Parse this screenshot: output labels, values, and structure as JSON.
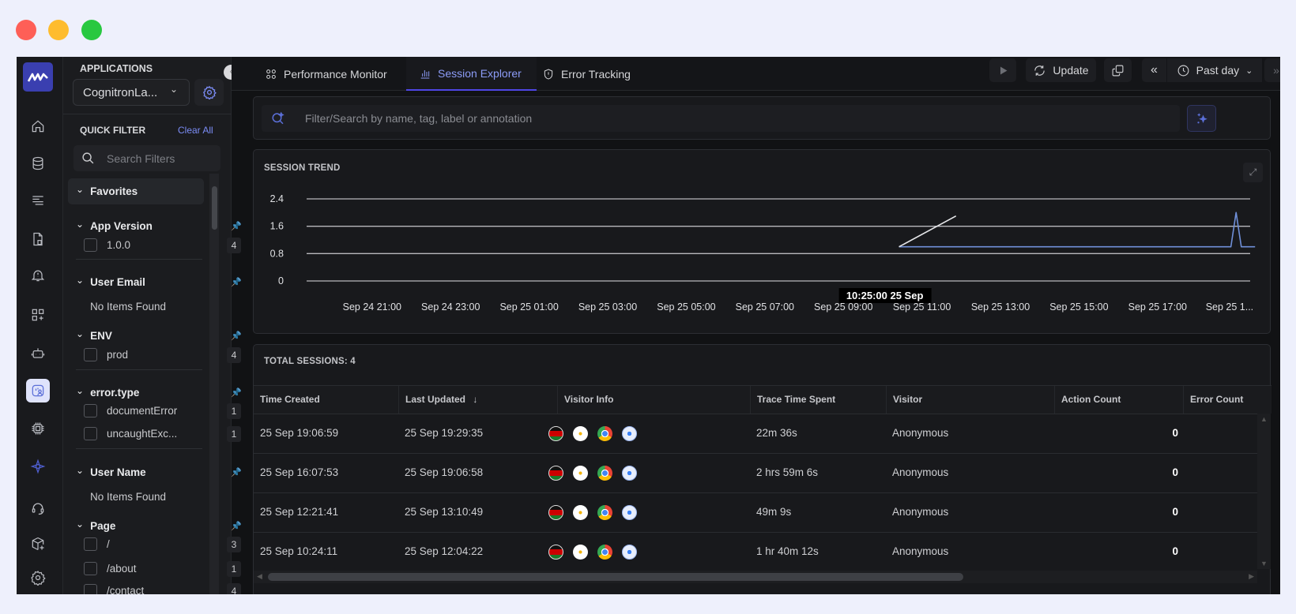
{
  "colors": {
    "accent": "#8c9cf7",
    "tab_underline": "#4f46e5",
    "series": "#6f8fd8",
    "pin": "#6f8fe0",
    "logo_bg": "#3a3fb0"
  },
  "window_controls": [
    "close",
    "minimize",
    "maximize"
  ],
  "rail": {
    "logo": "brand-logo",
    "items": [
      {
        "icon": "home-icon"
      },
      {
        "icon": "database-icon"
      },
      {
        "icon": "logs-icon"
      },
      {
        "icon": "document-icon"
      },
      {
        "icon": "alert-bell-icon"
      },
      {
        "icon": "add-dashboard-icon"
      },
      {
        "icon": "robot-icon"
      },
      {
        "icon": "session-explorer-icon",
        "active": true
      },
      {
        "icon": "chip-icon"
      },
      {
        "icon": "ai-sparkle-icon"
      },
      {
        "icon": "headset-icon"
      },
      {
        "icon": "add-package-icon"
      },
      {
        "icon": "settings-icon"
      }
    ]
  },
  "panel": {
    "applications_label": "APPLICATIONS",
    "app_selected": "CognitronLa...",
    "quick_filter_label": "QUICK FILTER",
    "clear_all": "Clear All",
    "search_placeholder": "Search Filters",
    "favorites": "Favorites",
    "sections": [
      {
        "title": "App Version",
        "items": [
          {
            "label": "1.0.0",
            "count": "4"
          }
        ]
      },
      {
        "title": "User Email",
        "empty": "No Items Found"
      },
      {
        "title": "ENV",
        "items": [
          {
            "label": "prod",
            "count": "4"
          }
        ]
      },
      {
        "title": "error.type",
        "items": [
          {
            "label": "documentError",
            "count": "1"
          },
          {
            "label": "uncaughtExc...",
            "count": "1"
          }
        ]
      },
      {
        "title": "User Name",
        "empty": "No Items Found"
      },
      {
        "title": "Page",
        "items": [
          {
            "label": "/",
            "count": "3"
          },
          {
            "label": "/about",
            "count": "1"
          },
          {
            "label": "/contact",
            "count": "4"
          }
        ]
      }
    ]
  },
  "tabs": [
    {
      "label": "Performance Monitor",
      "icon": "apps-grid-icon"
    },
    {
      "label": "Session Explorer",
      "icon": "bar-chart-icon",
      "active": true
    },
    {
      "label": "Error Tracking",
      "icon": "error-shield-icon"
    }
  ],
  "toolbar": {
    "update": "Update",
    "time_range": "Past day"
  },
  "search": {
    "placeholder": "Filter/Search by name, tag, label or annotation"
  },
  "chart_title": "SESSION TREND",
  "chart_data": {
    "type": "line",
    "title": "SESSION TREND",
    "ylim": [
      0,
      2.4
    ],
    "yticks": [
      "2.4",
      "1.6",
      "0.8",
      "0"
    ],
    "yvalues": [
      2.4,
      1.6,
      0.8,
      0
    ],
    "xlim": [
      "09-24 19:20",
      "09-25 19:42"
    ],
    "xticks": [
      {
        "t": "09-24 21:00",
        "label": "Sep 24 21:00"
      },
      {
        "t": "09-24 23:00",
        "label": "Sep 24 23:00"
      },
      {
        "t": "09-25 01:00",
        "label": "Sep 25 01:00"
      },
      {
        "t": "09-25 03:00",
        "label": "Sep 25 03:00"
      },
      {
        "t": "09-25 05:00",
        "label": "Sep 25 05:00"
      },
      {
        "t": "09-25 07:00",
        "label": "Sep 25 07:00"
      },
      {
        "t": "09-25 09:00",
        "label": "Sep 25 09:00"
      },
      {
        "t": "09-25 11:00",
        "label": "Sep 25 11:00"
      },
      {
        "t": "09-25 13:00",
        "label": "Sep 25 13:00"
      },
      {
        "t": "09-25 15:00",
        "label": "Sep 25 15:00"
      },
      {
        "t": "09-25 17:00",
        "label": "Sep 25 17:00"
      },
      {
        "t": "09-25 18:50",
        "label": "Sep 25 1..."
      }
    ],
    "grid": true,
    "series": [
      {
        "color": "#6f8fd8",
        "points": [
          [
            "09-25 10:25",
            1
          ],
          [
            "09-25 18:52",
            1
          ],
          [
            "09-25 19:00",
            2
          ],
          [
            "09-25 19:08",
            1
          ],
          [
            "09-25 19:29",
            1
          ]
        ]
      },
      {
        "color": "#e6e7ea",
        "points": [
          [
            "09-25 10:25",
            1
          ],
          [
            "09-25 11:52",
            1.9
          ]
        ]
      }
    ],
    "tooltip": "10:25:00 25 Sep"
  },
  "table": {
    "total_label": "TOTAL SESSIONS: 4",
    "columns": [
      "Time Created",
      "Last Updated",
      "Visitor Info",
      "Trace Time Spent",
      "Visitor",
      "Action Count",
      "Error Count"
    ],
    "sort_icon": "arrow-down-icon",
    "rows": [
      {
        "created": "25 Sep 19:06:59",
        "updated": "25 Sep 19:29:35",
        "trace": "22m 36s",
        "visitor": "Anonymous",
        "actions": "0"
      },
      {
        "created": "25 Sep 16:07:53",
        "updated": "25 Sep 19:06:58",
        "trace": "2 hrs 59m 6s",
        "visitor": "Anonymous",
        "actions": "0"
      },
      {
        "created": "25 Sep 12:21:41",
        "updated": "25 Sep 13:10:49",
        "trace": "49m 9s",
        "visitor": "Anonymous",
        "actions": "0"
      },
      {
        "created": "25 Sep 10:24:11",
        "updated": "25 Sep 12:04:22",
        "trace": "1 hr 40m 12s",
        "visitor": "Anonymous",
        "actions": "0"
      }
    ],
    "visitor_icons": [
      "kenya-flag-icon",
      "windows-icon",
      "chrome-icon",
      "replay-icon"
    ]
  }
}
